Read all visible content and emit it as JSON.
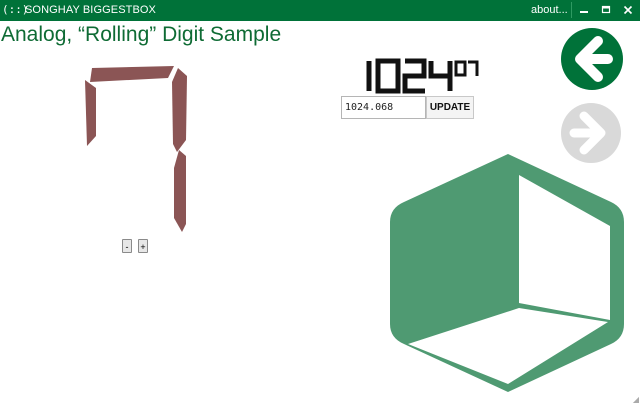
{
  "window": {
    "icon_text": "(::)",
    "title": "SONGHAY BIGGESTBOX",
    "about_label": "about...",
    "minimize_icon": "minimize-icon",
    "maximize_icon": "maximize-icon",
    "close_icon": "close-icon",
    "titlebar_color": "#007239"
  },
  "page": {
    "title": "Analog, “Rolling” Digit Sample"
  },
  "digit_display": {
    "digit": "7",
    "segment_color": "#8b5555",
    "decrement_label": "-",
    "increment_label": "+"
  },
  "counter": {
    "display_main": "1024",
    "display_fraction": "07",
    "input_value": "1024.068",
    "update_label": "UPDATE"
  },
  "navigation": {
    "back_icon": "arrow-left-icon",
    "forward_icon": "arrow-right-icon",
    "back_color": "#007239",
    "forward_color": "#d9d9d9"
  },
  "logo": {
    "icon": "cube-logo-icon",
    "color": "#4f9a72"
  }
}
